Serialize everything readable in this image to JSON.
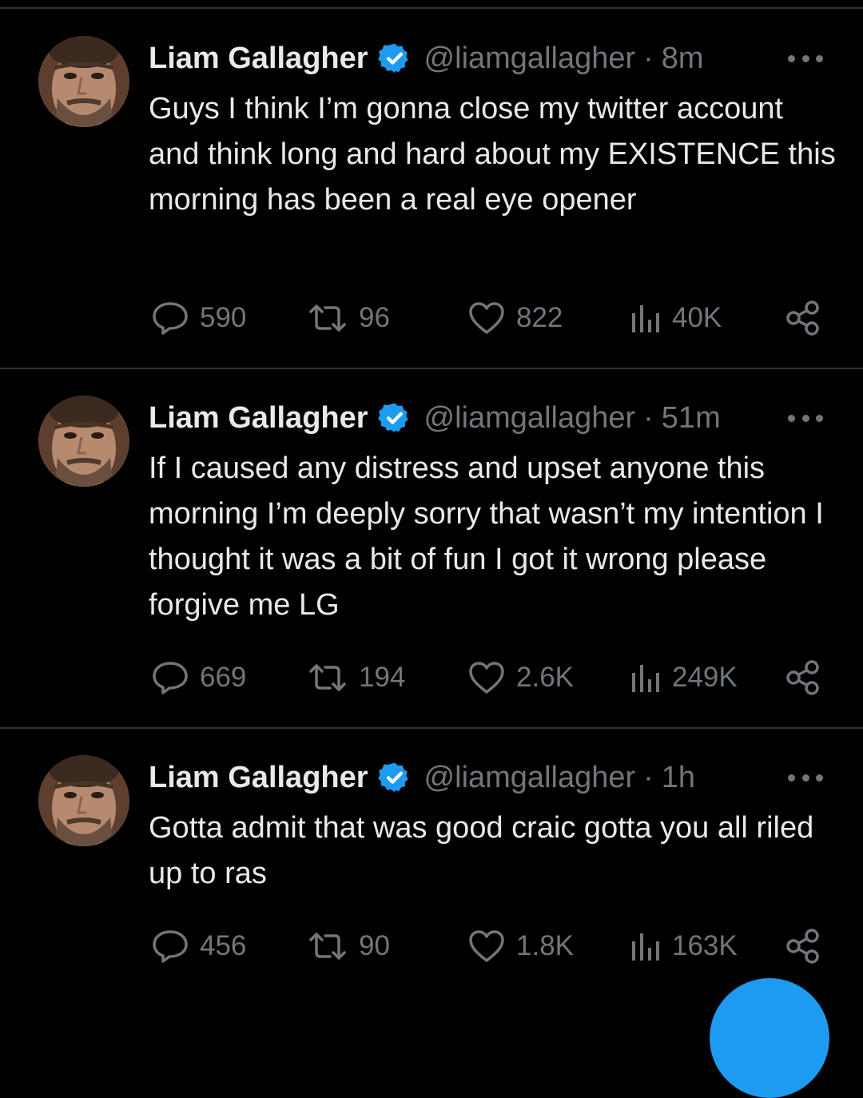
{
  "accent_color": "#1d9bf0",
  "tweets": [
    {
      "name": "Liam Gallagher",
      "handle": "@liamgallagher",
      "separator": "·",
      "time": "8m",
      "text": "Guys I think I’m gonna close my twitter account and think long and hard about my EXISTENCE this morning has been a real eye opener",
      "replies": "590",
      "retweets": "96",
      "likes": "822",
      "views": "40K"
    },
    {
      "name": "Liam Gallagher",
      "handle": "@liamgallagher",
      "separator": "·",
      "time": "51m",
      "text": "If I caused any distress and upset anyone this morning I’m deeply sorry that wasn’t my intention I thought it was a bit of fun I got it wrong please forgive me LG",
      "replies": "669",
      "retweets": "194",
      "likes": "2.6K",
      "views": "249K"
    },
    {
      "name": "Liam Gallagher",
      "handle": "@liamgallagher",
      "separator": "·",
      "time": "1h",
      "text": "Gotta admit that was good craic gotta you all riled up to ras",
      "replies": "456",
      "retweets": "90",
      "likes": "1.8K",
      "views": "163K"
    }
  ]
}
